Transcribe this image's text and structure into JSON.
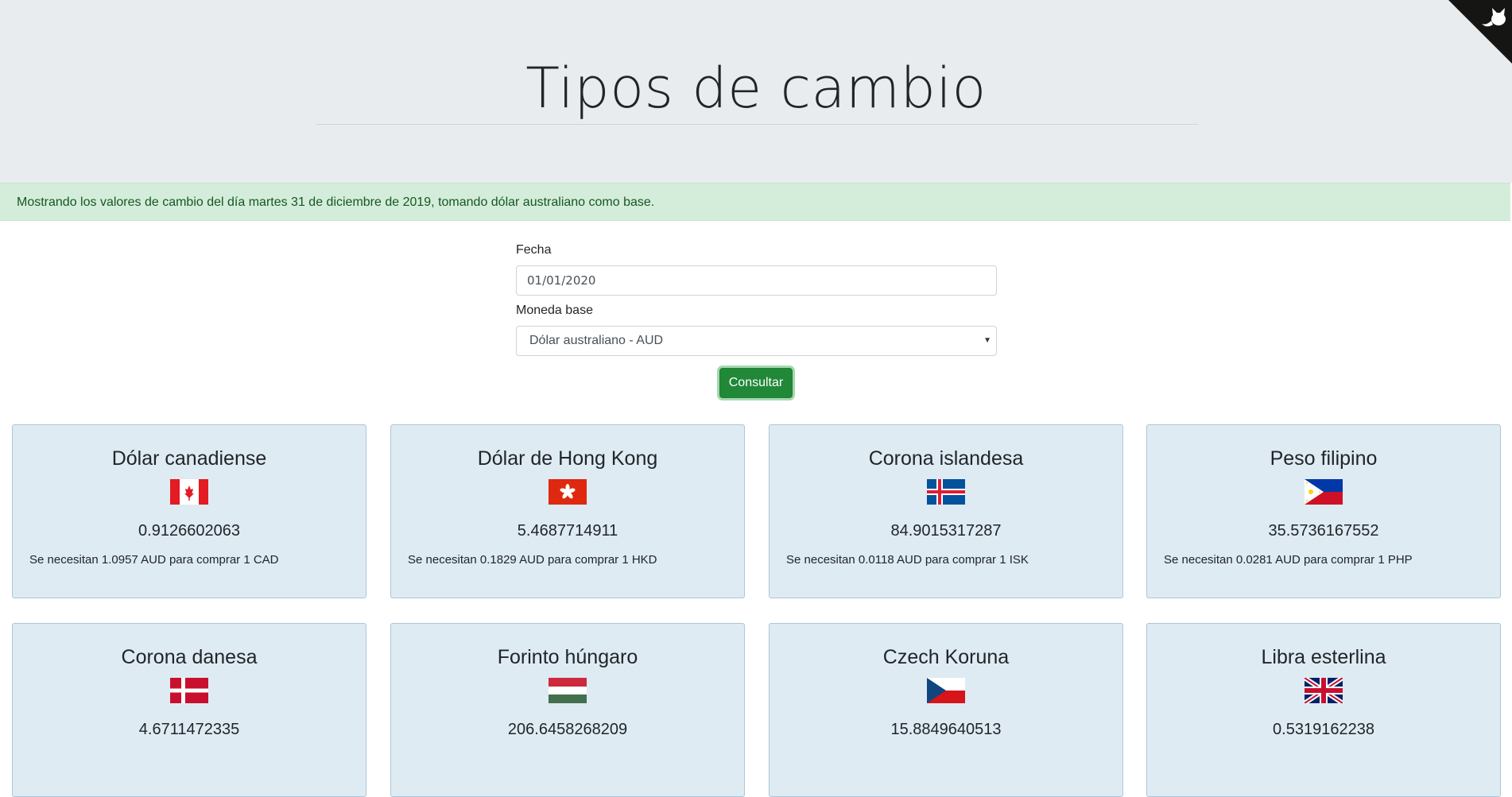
{
  "header": {
    "title": "Tipos de cambio"
  },
  "alert": {
    "text": "Mostrando los valores de cambio del día martes 31 de diciembre de 2019, tomando dólar australiano como base."
  },
  "form": {
    "date_label": "Fecha",
    "date_value": "01/01/2020",
    "base_label": "Moneda base",
    "base_value": "Dólar australiano - AUD",
    "submit_label": "Consultar"
  },
  "cards": [
    {
      "name": "Dólar canadiense",
      "flag": "canada-flag-icon",
      "rate": "0.9126602063",
      "note": "Se necesitan 1.0957 AUD para comprar 1 CAD"
    },
    {
      "name": "Dólar de Hong Kong",
      "flag": "hong-kong-flag-icon",
      "rate": "5.4687714911",
      "note": "Se necesitan 0.1829 AUD para comprar 1 HKD"
    },
    {
      "name": "Corona islandesa",
      "flag": "iceland-flag-icon",
      "rate": "84.9015317287",
      "note": "Se necesitan 0.0118 AUD para comprar 1 ISK"
    },
    {
      "name": "Peso filipino",
      "flag": "philippines-flag-icon",
      "rate": "35.5736167552",
      "note": "Se necesitan 0.0281 AUD para comprar 1 PHP"
    },
    {
      "name": "Corona danesa",
      "flag": "denmark-flag-icon",
      "rate": "4.6711472335",
      "note": ""
    },
    {
      "name": "Forinto húngaro",
      "flag": "hungary-flag-icon",
      "rate": "206.6458268209",
      "note": ""
    },
    {
      "name": "Czech Koruna",
      "flag": "czech-flag-icon",
      "rate": "15.8849640513",
      "note": ""
    },
    {
      "name": "Libra esterlina",
      "flag": "uk-flag-icon",
      "rate": "0.5319162238",
      "note": ""
    }
  ],
  "colors": {
    "header_bg": "#e9ecef",
    "alert_bg": "#d4edda",
    "alert_text": "#155724",
    "card_bg": "#deebf3",
    "button_bg": "#218838"
  }
}
